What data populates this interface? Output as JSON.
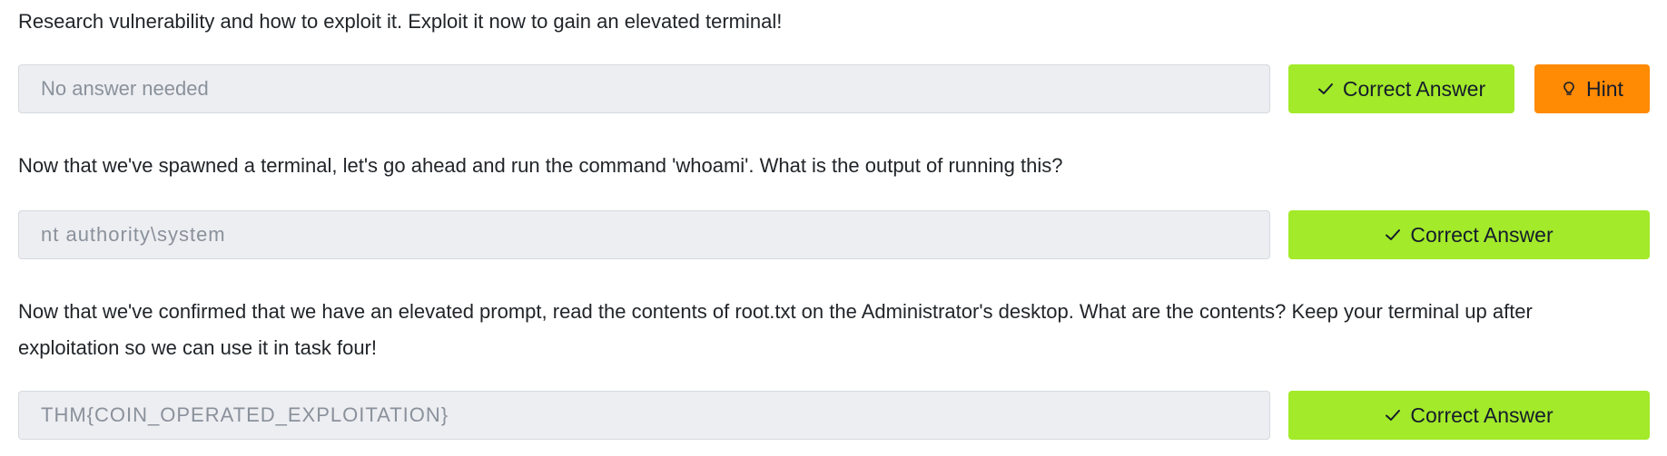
{
  "questions": [
    {
      "text": "Research vulnerability and how to exploit it. Exploit it now to gain an elevated terminal!",
      "answer_placeholder": "No answer needed",
      "answer_value": "",
      "correct_label": "Correct Answer",
      "hint_label": "Hint"
    },
    {
      "text": "Now that we've spawned a terminal, let's go ahead and run the command 'whoami'. What is the output of running this?",
      "answer_placeholder": "",
      "answer_value": "nt authority\\system",
      "correct_label": "Correct Answer"
    },
    {
      "text": "Now that we've confirmed that we have an elevated prompt, read the contents of root.txt on the Administrator's desktop. What are the contents? Keep your terminal up after exploitation so we can use it in task four!",
      "answer_placeholder": "",
      "answer_value": "THM{COIN_OPERATED_EXPLOITATION}",
      "correct_label": "Correct Answer"
    }
  ],
  "colors": {
    "correct": "#a3ea2a",
    "hint": "#ff8a03",
    "field_bg": "#edeef2",
    "field_text": "#8a919b"
  },
  "icons": {
    "correct": "check-icon",
    "hint": "lightbulb-icon"
  }
}
